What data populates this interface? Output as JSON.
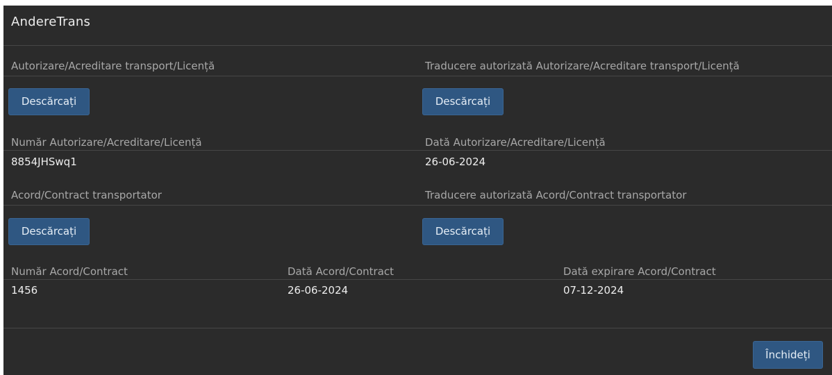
{
  "modal": {
    "title": "AndereTrans"
  },
  "license_section": {
    "document_label": "Autorizare/Acreditare transport/Licență",
    "translation_label": "Traducere autorizată Autorizare/Acreditare transport/Licență",
    "download_label": "Descărcați",
    "translation_download_label": "Descărcați",
    "number_label": "Număr Autorizare/Acreditare/Licență",
    "number_value": "8854JHSwq1",
    "date_label": "Dată Autorizare/Acreditare/Licență",
    "date_value": "26-06-2024"
  },
  "contract_section": {
    "document_label": "Acord/Contract transportator",
    "translation_label": "Traducere autorizată Acord/Contract transportator",
    "download_label": "Descărcați",
    "translation_download_label": "Descărcați",
    "number_label": "Număr Acord/Contract",
    "number_value": "1456",
    "date_label": "Dată Acord/Contract",
    "date_value": "26-06-2024",
    "expiry_label": "Dată expirare Acord/Contract",
    "expiry_value": "07-12-2024"
  },
  "footer": {
    "close_label": "Închideți"
  },
  "colors": {
    "modal_background": "#2b2b2b",
    "button_background": "#2f5782",
    "label_text": "#a8a8a8",
    "value_text": "#eeeeee",
    "divider": "#474747"
  }
}
